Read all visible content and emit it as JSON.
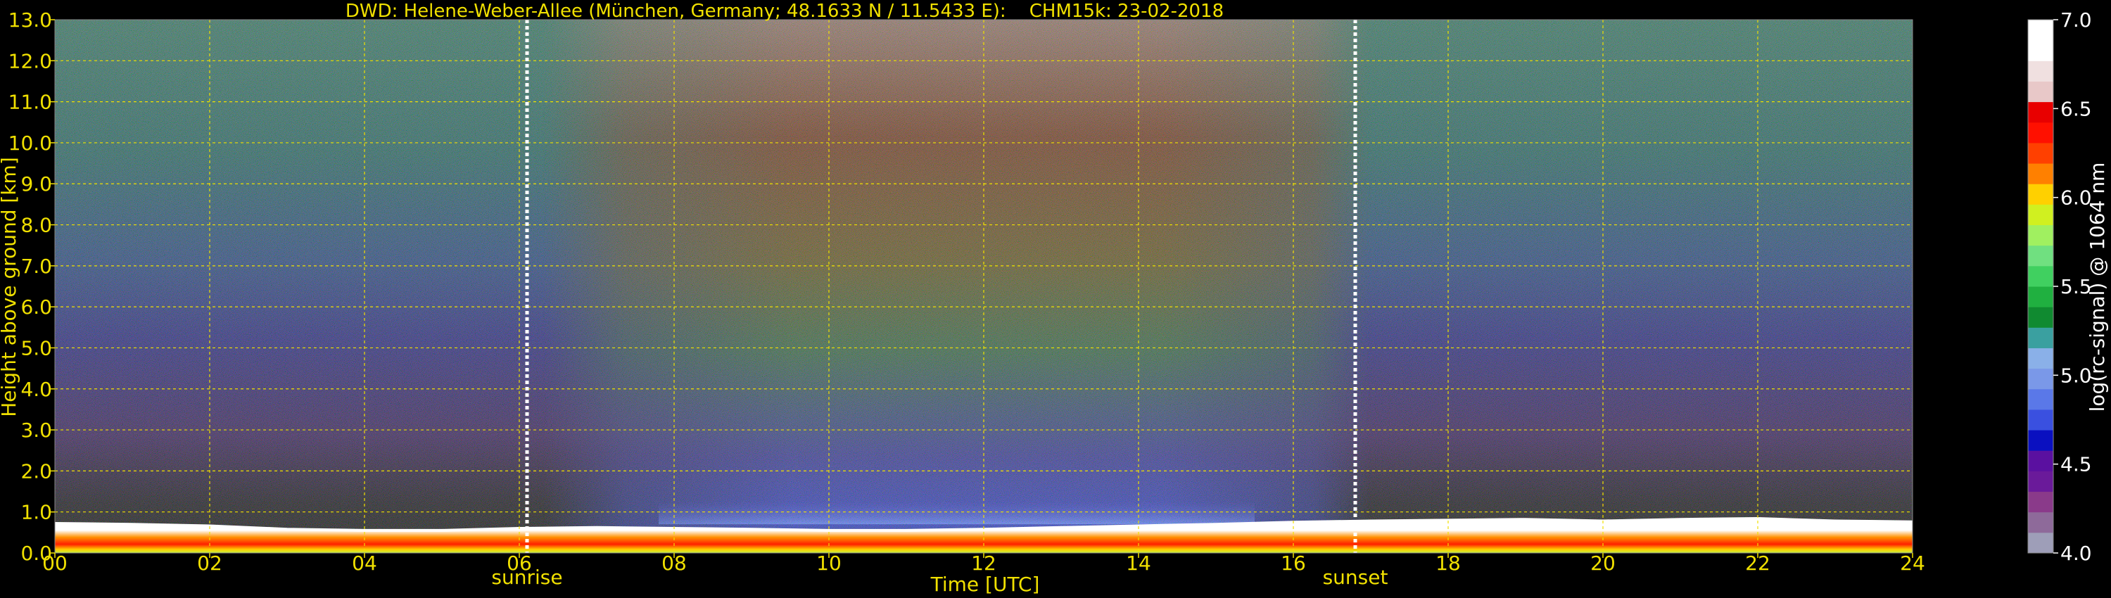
{
  "chart_data": {
    "type": "heatmap",
    "title": "DWD: Helene-Weber-Allee (München, Germany; 48.1633 N / 11.5433 E):    CHM15k: 23-02-2018",
    "xlabel": "Time [UTC]",
    "ylabel": "Height above ground [km]",
    "xlim": [
      0,
      24
    ],
    "ylim": [
      0,
      13
    ],
    "x_ticks": [
      0,
      2,
      4,
      6,
      8,
      10,
      12,
      14,
      16,
      18,
      20,
      22,
      24
    ],
    "x_tick_labels": [
      "00",
      "02",
      "04",
      "06",
      "08",
      "10",
      "12",
      "14",
      "16",
      "18",
      "20",
      "22",
      "24"
    ],
    "y_ticks": [
      0,
      1,
      2,
      3,
      4,
      5,
      6,
      7,
      8,
      9,
      10,
      11,
      12,
      13
    ],
    "y_tick_labels": [
      "0.0",
      "1.0",
      "2.0",
      "3.0",
      "4.0",
      "5.0",
      "6.0",
      "7.0",
      "8.0",
      "9.0",
      "10.0",
      "11.0",
      "12.0",
      "13.0"
    ],
    "grid": true,
    "markers": [
      {
        "label": "sunrise",
        "x": 6.1
      },
      {
        "label": "sunset",
        "x": 16.8
      }
    ],
    "colorbar": {
      "label": "log(rc-signal) @ 1064 nm",
      "range": [
        4.0,
        7.0
      ],
      "ticks": [
        4.0,
        4.5,
        5.0,
        5.5,
        6.0,
        6.5,
        7.0
      ],
      "tick_labels": [
        "4.0",
        "4.5",
        "5.0",
        "5.5",
        "6.0",
        "6.5",
        "7.0"
      ],
      "colors": [
        "#9e9eb8",
        "#8e6a9a",
        "#8a3a8a",
        "#6a1a9a",
        "#5a10a0",
        "#0a10c0",
        "#3a50e0",
        "#5a78e8",
        "#7a98e8",
        "#8ab0e8",
        "#3aa0a0",
        "#108a30",
        "#20b040",
        "#40d060",
        "#70e080",
        "#a0f060",
        "#d0f020",
        "#ffd000",
        "#ff8000",
        "#ff4000",
        "#ff1000",
        "#e80000",
        "#e8c8c8",
        "#f0e0e0",
        "#ffffff",
        "#ffffff"
      ]
    },
    "color_hex": {
      "text": "#f0e000",
      "grid": "#f0e000",
      "markers": "#ffffff"
    }
  }
}
